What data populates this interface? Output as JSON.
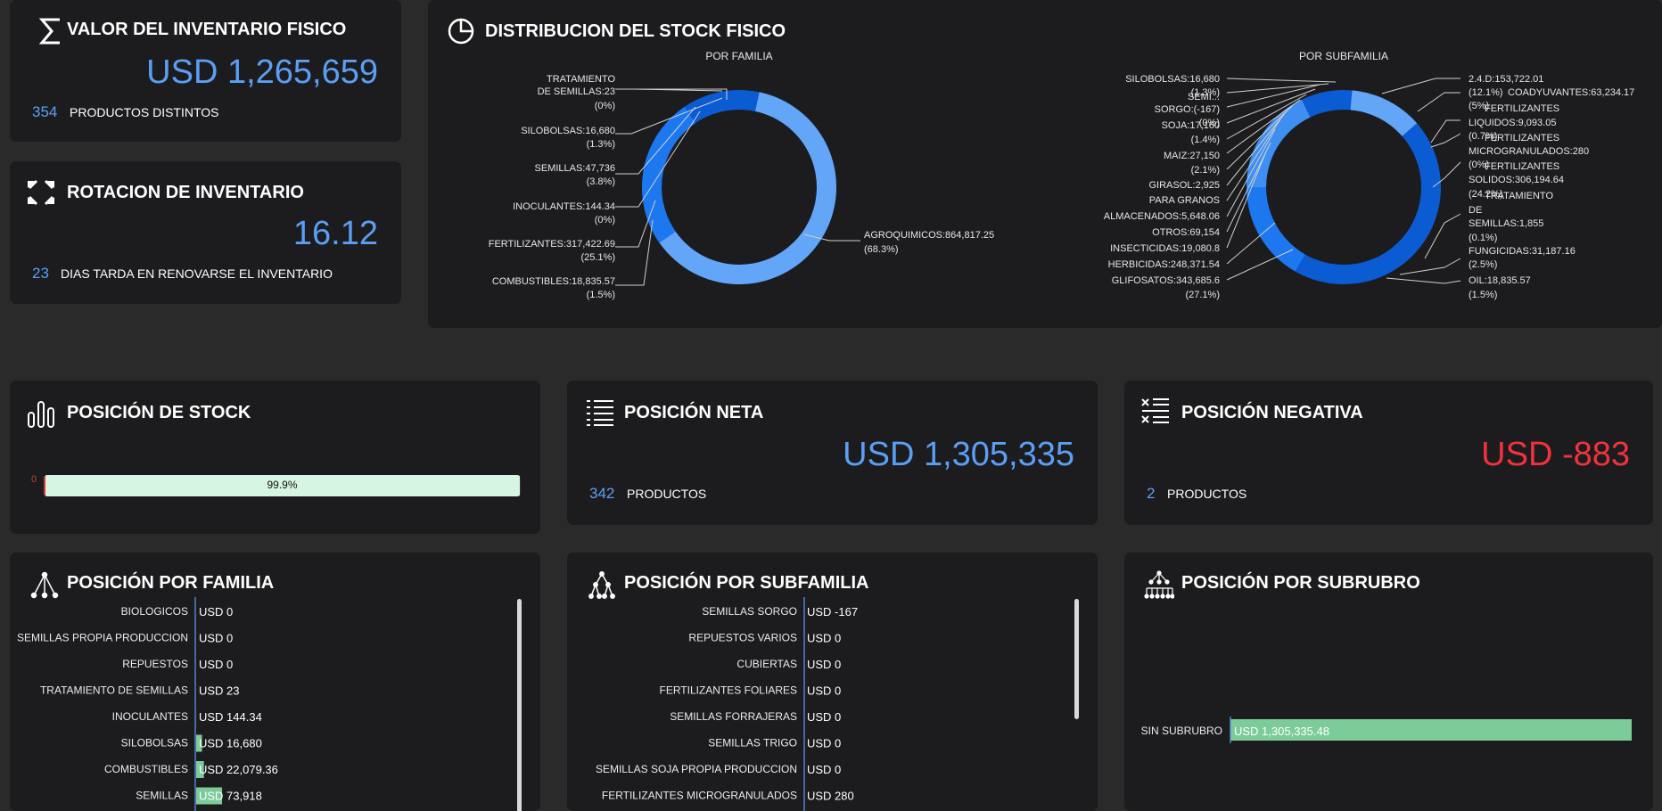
{
  "colors": {
    "accent": "#5b9ff5",
    "negative": "#f0323d",
    "bar_green": "#7ecb9a",
    "progress_fill": "#d6f5e3",
    "donut_light": "#63a6f7",
    "donut_mid": "#1d78f0",
    "donut_dark": "#0b5bd3"
  },
  "valor": {
    "title": "VALOR DEL INVENTARIO FISICO",
    "icon": "sigma-icon",
    "value": "USD 1,265,659",
    "count": "354",
    "count_label": "PRODUCTOS DISTINTOS"
  },
  "rotacion": {
    "title": "ROTACION DE INVENTARIO",
    "icon": "rotate-icon",
    "value": "16.12",
    "count": "23",
    "count_label": "DIAS TARDA EN RENOVARSE EL INVENTARIO"
  },
  "distribucion": {
    "title": "DISTRIBUCION DEL STOCK FISICO",
    "icon": "pie-chart-icon",
    "familia": {
      "subtitle": "POR FAMILIA",
      "labels_left": [
        [
          "TRATAMIENTO",
          "DE SEMILLAS:23",
          "(0%)"
        ],
        [
          "SILOBOLSAS:16,680",
          "(1.3%)"
        ],
        [
          "SEMILLAS:47,736",
          "(3.8%)"
        ],
        [
          "INOCULANTES:144.34",
          "(0%)"
        ],
        [
          "FERTILIZANTES:317,422.69",
          "(25.1%)"
        ],
        [
          "COMBUSTIBLES:18,835.57",
          "(1.5%)"
        ]
      ],
      "labels_right": [
        [
          "AGROQUIMICOS:864,817.25",
          "(68.3%)"
        ]
      ]
    },
    "subfamilia": {
      "subtitle": "POR SUBFAMILIA",
      "labels_left": [
        "SILOBOLSAS:16,680",
        "(1.3%)",
        "SEMI...",
        "SORGO:(-167)",
        "(0%)",
        "SOJA:17,160",
        "(1.4%)",
        "MAIZ:27,150",
        "(2.1%)",
        "GIRASOL:2,925",
        "PARA GRANOS",
        "ALMACENADOS:5,648.06",
        "OTROS:69,154",
        "INSECTICIDAS:19,080.8",
        "HERBICIDAS:248,371.54",
        "GLIFOSATOS:343,685.6",
        "(27.1%)"
      ],
      "labels_right": [
        "2.4.D:153,722.01",
        "(12.1%)",
        "COADYUVANTES:63,234.17",
        "(5%)",
        "FERTILIZANTES",
        "LIQUIDOS:9,093.05",
        "(0.7%)",
        "FERTILIZANTES",
        "MICROGRANULADOS:280",
        "(0%)",
        "FERTILIZANTES",
        "SOLIDOS:306,194.64",
        "(24.2%)",
        "TRATAMIENTO",
        "DE",
        "SEMILLAS:1,855",
        "(0.1%)",
        "FUNGICIDAS:31,187.16",
        "(2.5%)",
        "OIL:18,835.57",
        "(1.5%)"
      ]
    }
  },
  "posicion_stock": {
    "title": "POSICIÓN DE STOCK",
    "icon": "bar-chart-icon",
    "bar_label": "99.9%",
    "left_label": "0",
    "fill_fraction": 0.999
  },
  "posicion_neta": {
    "title": "POSICIÓN NETA",
    "icon": "list-icon",
    "value": "USD 1,305,335",
    "count": "342",
    "count_label": "PRODUCTOS"
  },
  "posicion_negativa": {
    "title": "POSICIÓN NEGATIVA",
    "icon": "x-list-icon",
    "value": "USD -883",
    "count": "2",
    "count_label": "PRODUCTOS"
  },
  "por_familia": {
    "title": "POSICIÓN POR FAMILIA",
    "icon": "tree-icon",
    "rows": [
      {
        "label": "BIOLOGICOS",
        "value": "USD 0",
        "amount": 0
      },
      {
        "label": "SEMILLAS PROPIA PRODUCCION",
        "value": "USD 0",
        "amount": 0
      },
      {
        "label": "REPUESTOS",
        "value": "USD 0",
        "amount": 0
      },
      {
        "label": "TRATAMIENTO DE SEMILLAS",
        "value": "USD 23",
        "amount": 23
      },
      {
        "label": "INOCULANTES",
        "value": "USD 144.34",
        "amount": 144.34
      },
      {
        "label": "SILOBOLSAS",
        "value": "USD 16,680",
        "amount": 16680
      },
      {
        "label": "COMBUSTIBLES",
        "value": "USD 22,079.36",
        "amount": 22079.36
      },
      {
        "label": "SEMILLAS",
        "value": "USD 73,918",
        "amount": 73918
      }
    ]
  },
  "por_subfamilia": {
    "title": "POSICIÓN POR SUBFAMILIA",
    "icon": "tree-icon",
    "rows": [
      {
        "label": "SEMILLAS SORGO",
        "value": "USD -167"
      },
      {
        "label": "REPUESTOS VARIOS",
        "value": "USD 0"
      },
      {
        "label": "CUBIERTAS",
        "value": "USD 0"
      },
      {
        "label": "FERTILIZANTES FOLIARES",
        "value": "USD 0"
      },
      {
        "label": "SEMILLAS FORRAJERAS",
        "value": "USD 0"
      },
      {
        "label": "SEMILLAS TRIGO",
        "value": "USD 0"
      },
      {
        "label": "SEMILLAS SOJA PROPIA PRODUCCION",
        "value": "USD 0"
      },
      {
        "label": "FERTILIZANTES MICROGRANULADOS",
        "value": "USD 280"
      }
    ]
  },
  "por_subrubro": {
    "title": "POSICIÓN POR SUBRUBRO",
    "icon": "tree-icon",
    "rows": [
      {
        "label": "SIN SUBRUBRO",
        "value": "USD 1,305,335.48",
        "amount": 1305335.48
      }
    ]
  }
}
